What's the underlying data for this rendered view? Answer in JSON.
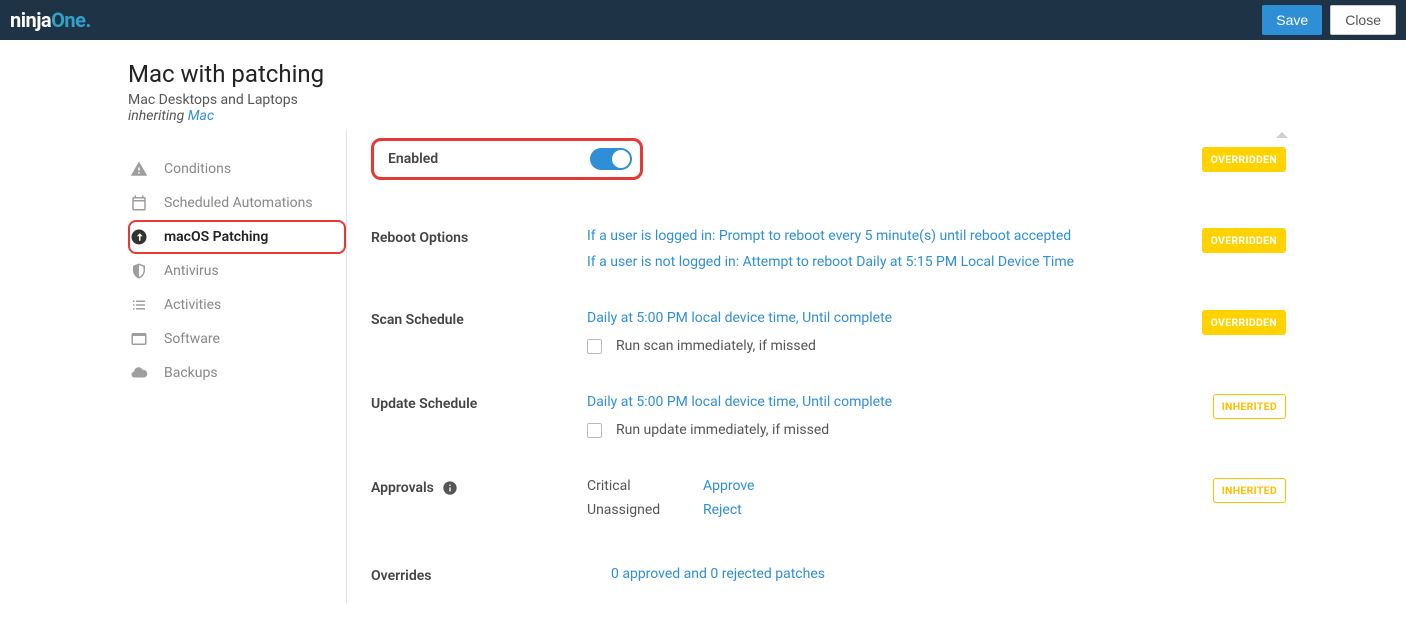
{
  "header": {
    "logo_ninja": "ninja",
    "logo_one": "One",
    "save": "Save",
    "close": "Close"
  },
  "page": {
    "title": "Mac with patching",
    "subtitle_prefix": "Mac Desktops and Laptops ",
    "inheriting_word": "inheriting ",
    "parent": "Mac"
  },
  "sidebar": {
    "items": [
      {
        "label": "Conditions",
        "icon": "warning"
      },
      {
        "label": "Scheduled Automations",
        "icon": "calendar"
      },
      {
        "label": "macOS Patching",
        "icon": "patch",
        "active": true,
        "highlighted": true
      },
      {
        "label": "Antivirus",
        "icon": "shield"
      },
      {
        "label": "Activities",
        "icon": "list"
      },
      {
        "label": "Software",
        "icon": "window"
      },
      {
        "label": "Backups",
        "icon": "cloud"
      }
    ]
  },
  "badges": {
    "overridden": "OVERRIDDEN",
    "inherited": "INHERITED"
  },
  "enabled": {
    "label": "Enabled"
  },
  "reboot": {
    "label": "Reboot Options",
    "line1": "If a user is logged in: Prompt to reboot every 5 minute(s) until reboot accepted",
    "line2": "If a user is not logged in: Attempt to reboot Daily at 5:15 PM Local Device Time"
  },
  "scan": {
    "label": "Scan Schedule",
    "value": "Daily at 5:00 PM local device time, Until complete",
    "checkbox_label": "Run scan immediately, if missed"
  },
  "update": {
    "label": "Update Schedule",
    "value": "Daily at 5:00 PM local device time, Until complete",
    "checkbox_label": "Run update immediately, if missed"
  },
  "approvals": {
    "label": "Approvals",
    "rows": [
      {
        "name": "Critical",
        "action": "Approve"
      },
      {
        "name": "Unassigned",
        "action": "Reject"
      }
    ]
  },
  "overrides": {
    "label": "Overrides",
    "value": "0 approved and 0 rejected patches"
  }
}
